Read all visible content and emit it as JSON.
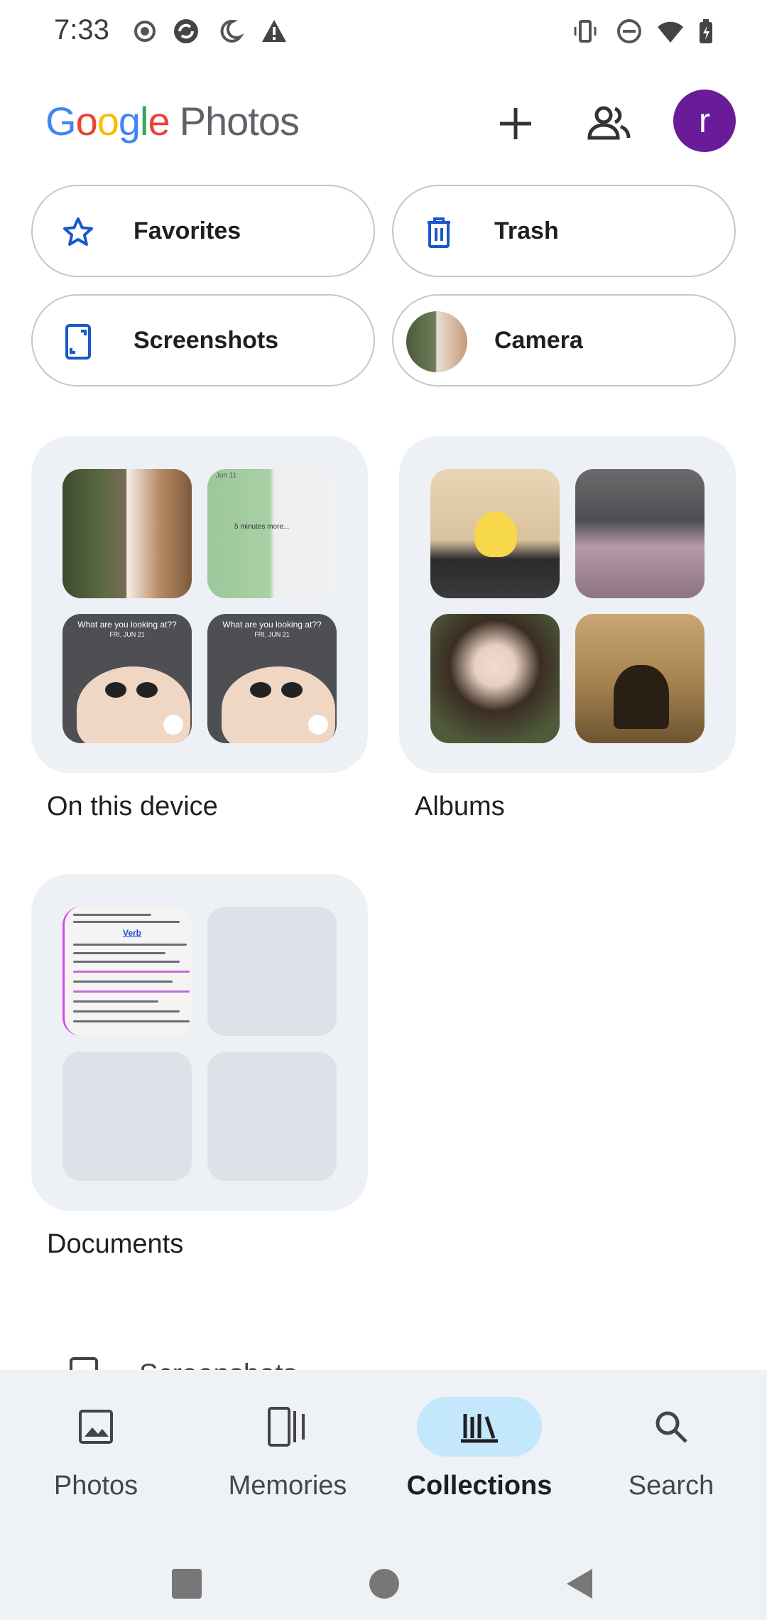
{
  "status_bar": {
    "time": "7:33"
  },
  "header": {
    "logo_letters": [
      "G",
      "o",
      "o",
      "g",
      "l",
      "e"
    ],
    "product": "Photos",
    "avatar_letter": "r",
    "icons": [
      "add-icon",
      "shared-people-icon"
    ]
  },
  "chips": [
    {
      "label": "Favorites",
      "icon": "star-icon"
    },
    {
      "label": "Trash",
      "icon": "trash-icon"
    },
    {
      "label": "Screenshots",
      "icon": "screenshot-icon"
    },
    {
      "label": "Camera",
      "icon": "camera-thumbnail"
    }
  ],
  "collections": [
    {
      "title": "On this device"
    },
    {
      "title": "Albums"
    },
    {
      "title": "Documents"
    }
  ],
  "thumb_text": {
    "lock_caption": "What are you looking at??",
    "date_caption": "FRI, JUN 21",
    "doc_heading": "Verb",
    "cat_caption": "5 minutes more...",
    "cat_date": "Jun 11"
  },
  "partial_item": {
    "label": "Screenshots"
  },
  "bottom_nav": {
    "items": [
      {
        "label": "Photos",
        "icon": "photo-icon",
        "active": false
      },
      {
        "label": "Memories",
        "icon": "memories-icon",
        "active": false
      },
      {
        "label": "Collections",
        "icon": "collections-icon",
        "active": true
      },
      {
        "label": "Search",
        "icon": "search-icon",
        "active": false
      }
    ]
  },
  "colors": {
    "accent_active": "#c3e7fb",
    "avatar_bg": "#6a1b9a",
    "icon_blue": "#1a57c9",
    "nav_bg": "#eef1f6",
    "card_bg": "#edf1f6"
  }
}
